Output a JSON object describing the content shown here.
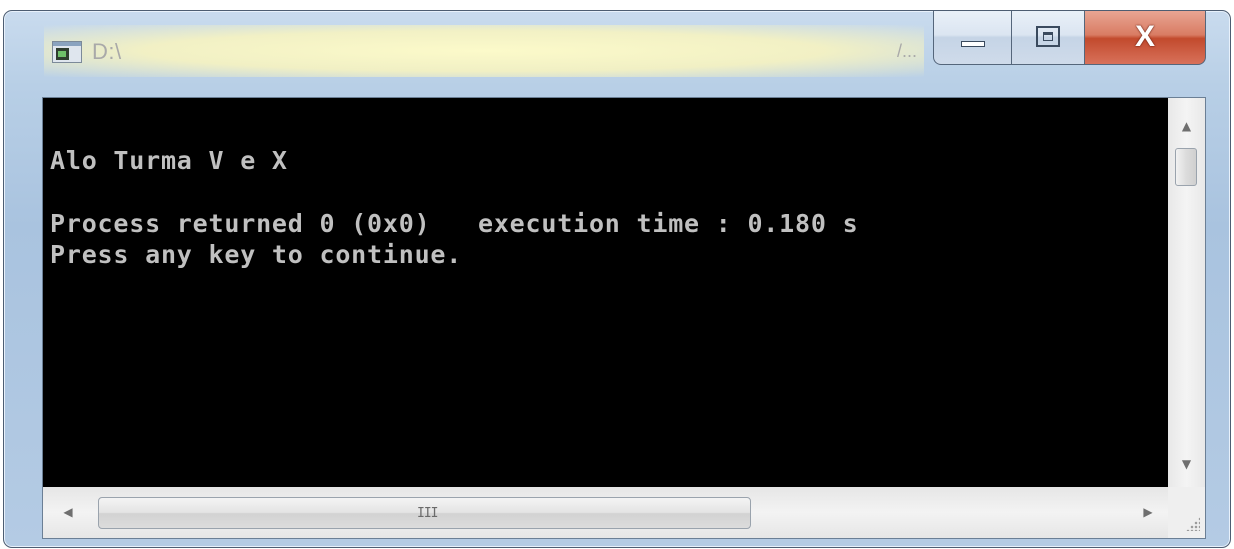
{
  "window": {
    "title": "D:\\",
    "title_ellipsis": "/...",
    "close_label": "X"
  },
  "console": {
    "lines": [
      "Alo Turma V e X",
      "",
      "Process returned 0 (0x0)   execution time : 0.180 s",
      "Press any key to continue."
    ]
  },
  "scrollbars": {
    "vertical": {
      "up_arrow": "▲",
      "down_arrow": "▼"
    },
    "horizontal": {
      "left_arrow": "◀",
      "right_arrow": "▶",
      "grip": "III"
    }
  },
  "colors": {
    "console_background": "#000000",
    "console_text": "#c0c0c0",
    "close_button": "#c24a2d"
  },
  "icons": [
    "console-app-icon",
    "minimize-icon",
    "maximize-icon",
    "close-icon",
    "size-grip-icon"
  ]
}
